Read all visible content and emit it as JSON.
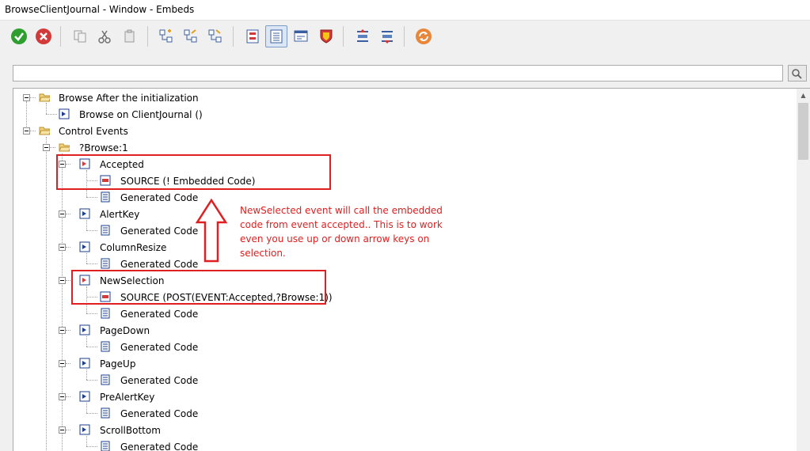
{
  "window": {
    "title": "BrowseClientJournal - Window - Embeds"
  },
  "toolbar": {
    "buttons": [
      {
        "name": "ok-button",
        "icon": "check-icon"
      },
      {
        "name": "cancel-button",
        "icon": "cancel-icon"
      },
      {
        "name": "copy-button",
        "icon": "copy-icon"
      },
      {
        "name": "cut-button",
        "icon": "cut-icon"
      },
      {
        "name": "paste-button",
        "icon": "paste-icon"
      },
      {
        "name": "insert-embed-button",
        "icon": "insert-node-icon"
      },
      {
        "name": "insert-before-button",
        "icon": "insert-before-icon"
      },
      {
        "name": "insert-after-button",
        "icon": "insert-after-icon"
      },
      {
        "name": "show-filled-button",
        "icon": "filled-icon"
      },
      {
        "name": "show-all-button",
        "icon": "list-view-icon"
      },
      {
        "name": "show-window-button",
        "icon": "window-icon"
      },
      {
        "name": "priority-button",
        "icon": "shield-icon"
      },
      {
        "name": "move-up-button",
        "icon": "move-up-icon"
      },
      {
        "name": "move-down-button",
        "icon": "move-down-icon"
      },
      {
        "name": "refresh-button",
        "icon": "refresh-icon"
      }
    ]
  },
  "filter": {
    "value": ""
  },
  "tree": {
    "items": [
      {
        "label": "Browse After the initialization"
      },
      {
        "label": "Browse on ClientJournal ()"
      },
      {
        "label": "Control Events"
      },
      {
        "label": "?Browse:1"
      },
      {
        "label": "Accepted"
      },
      {
        "label": "SOURCE (! Embedded Code)"
      },
      {
        "label": "Generated Code"
      },
      {
        "label": "AlertKey"
      },
      {
        "label": "Generated Code"
      },
      {
        "label": "ColumnResize"
      },
      {
        "label": "Generated Code"
      },
      {
        "label": "NewSelection"
      },
      {
        "label": "SOURCE (POST(EVENT:Accepted,?Browse:1))"
      },
      {
        "label": "Generated Code"
      },
      {
        "label": "PageDown"
      },
      {
        "label": "Generated Code"
      },
      {
        "label": "PageUp"
      },
      {
        "label": "Generated Code"
      },
      {
        "label": "PreAlertKey"
      },
      {
        "label": "Generated Code"
      },
      {
        "label": "ScrollBottom"
      },
      {
        "label": "Generated Code"
      }
    ]
  },
  "annotation": {
    "text": "NewSelected event will call the embedded code from event accepted.. This is to work even you use up or down arrow keys on selection.",
    "color": "#e02020"
  }
}
